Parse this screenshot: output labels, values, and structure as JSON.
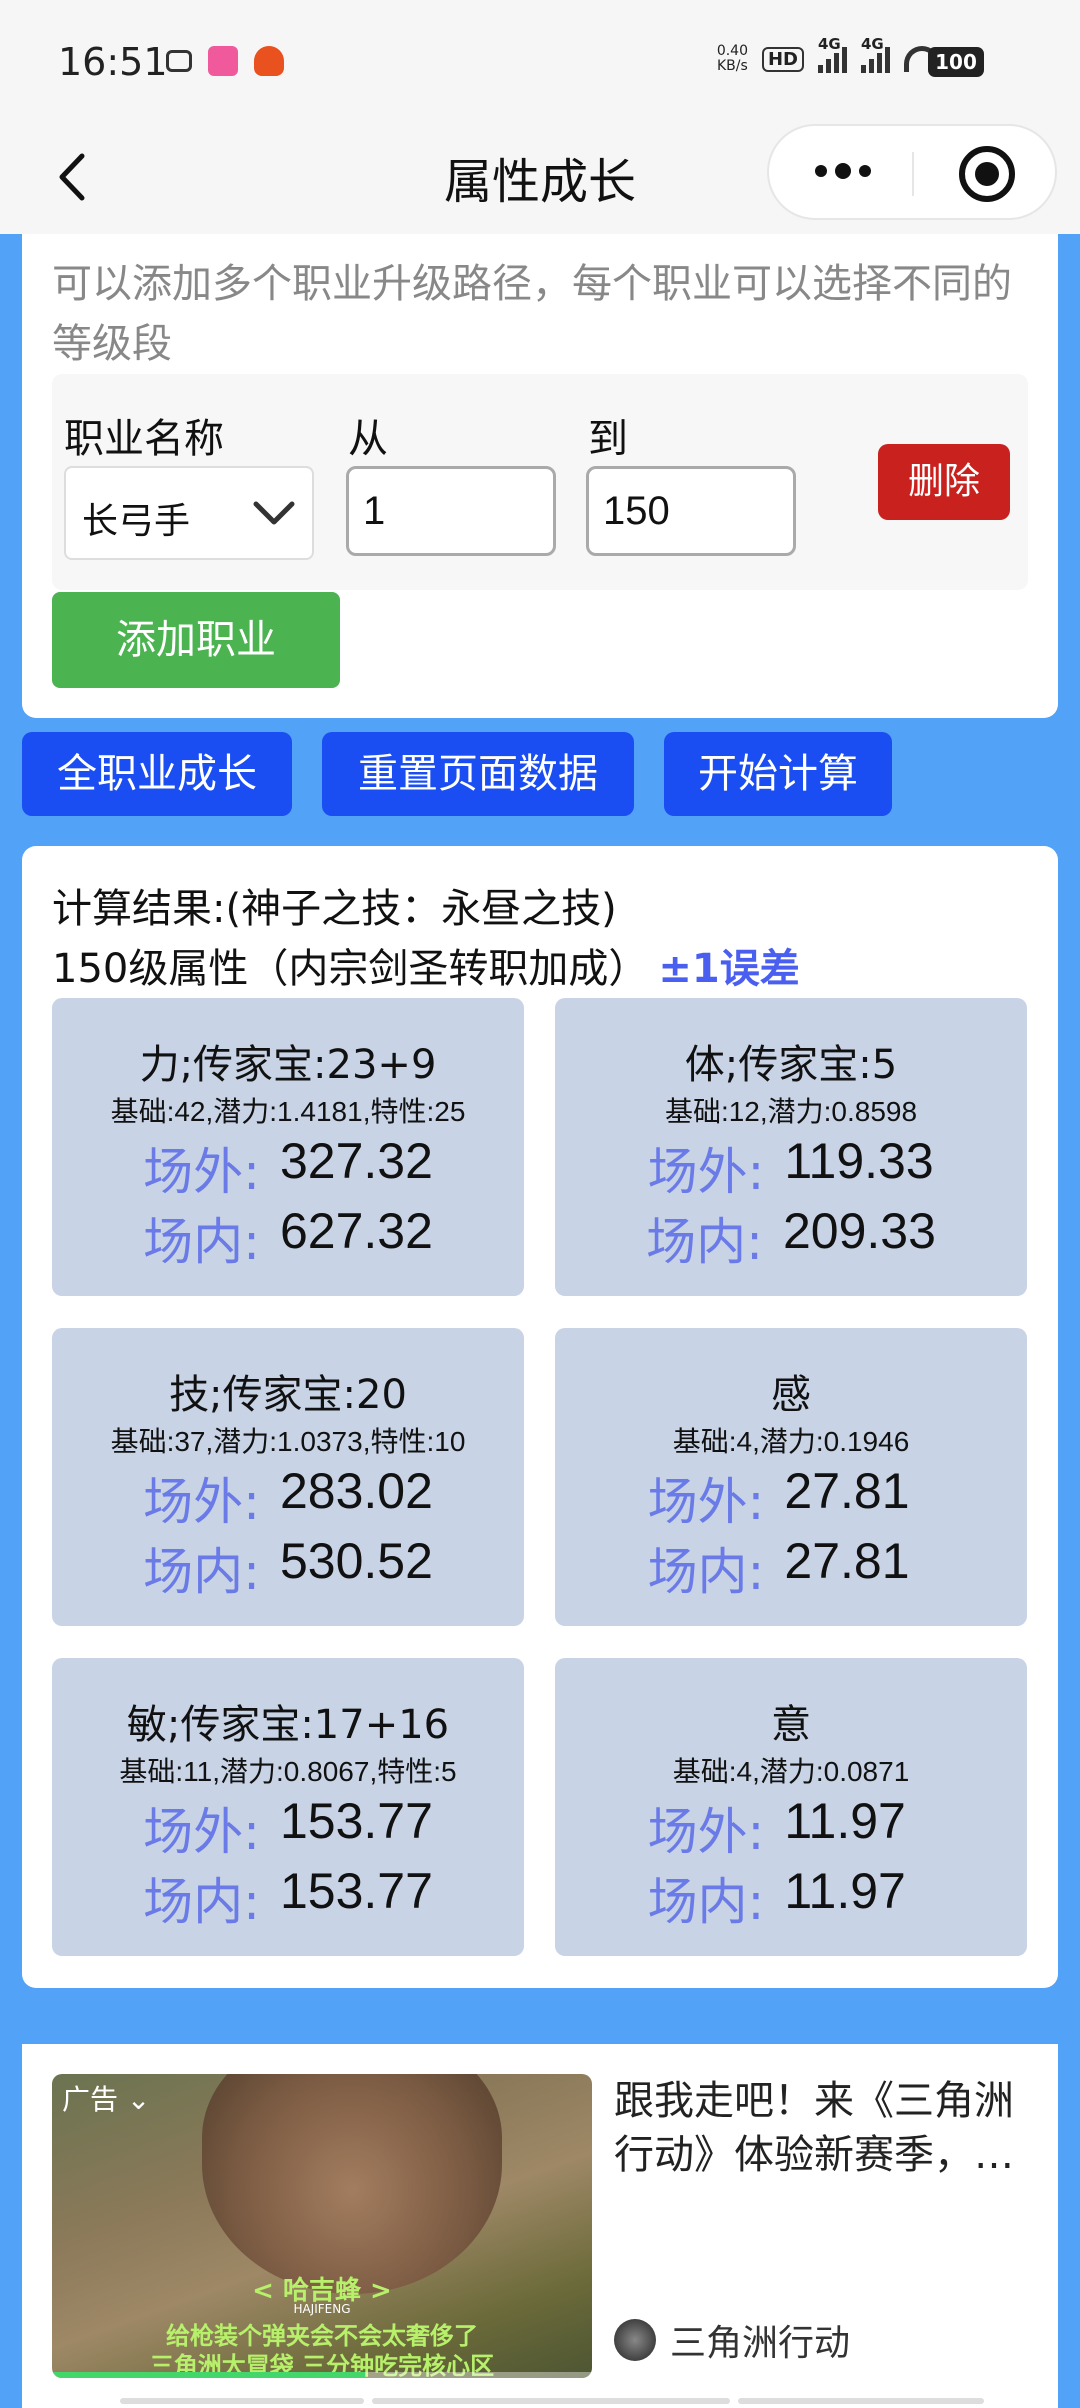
{
  "status": {
    "time": "16:51",
    "netspeed": "0.40",
    "netunit": "KB/s",
    "hd": "HD",
    "net1": "4G",
    "net2": "4G",
    "battery": "100"
  },
  "nav": {
    "title": "属性成长"
  },
  "config": {
    "tip": "可以添加多个职业升级路径，每个职业可以选择不同的等级段",
    "job_label": "职业名称",
    "from_label": "从",
    "to_label": "到",
    "job_value": "长弓手",
    "from_value": "1",
    "to_value": "150",
    "delete_label": "删除",
    "add_label": "添加职业"
  },
  "actions": {
    "all_growth": "全职业成长",
    "reset": "重置页面数据",
    "calculate": "开始计算"
  },
  "result": {
    "title": "计算结果:(神子之技：永昼之技)",
    "subtitle": "150级属性（内宗剑圣转职加成）",
    "error_note": "±1误差",
    "outside_label": "场外:",
    "inside_label": "场内:",
    "stats": [
      {
        "name": "力;传家宝:23+9",
        "base": "基础:42,潜力:1.4181,特性:25",
        "outside": "327.32",
        "inside": "627.32"
      },
      {
        "name": "体;传家宝:5",
        "base": "基础:12,潜力:0.8598",
        "outside": "119.33",
        "inside": "209.33"
      },
      {
        "name": "技;传家宝:20",
        "base": "基础:37,潜力:1.0373,特性:10",
        "outside": "283.02",
        "inside": "530.52"
      },
      {
        "name": "感",
        "base": "基础:4,潜力:0.1946",
        "outside": "27.81",
        "inside": "27.81"
      },
      {
        "name": "敏;传家宝:17+16",
        "base": "基础:11,潜力:0.8067,特性:5",
        "outside": "153.77",
        "inside": "153.77"
      },
      {
        "name": "意",
        "base": "基础:4,潜力:0.0871",
        "outside": "11.97",
        "inside": "11.97"
      }
    ]
  },
  "ad": {
    "tag": "广告",
    "cap1": "< 哈吉蜂 >",
    "cap2": "HAJIFENG",
    "cap3": "给枪装个弹夹会不会太奢侈了",
    "cap4": "三角洲大冒袋 三分钟吃完核心区",
    "text": "跟我走吧！来《三角洲行动》体验新赛季，…",
    "source": "三角洲行动",
    "progress": 0.58
  }
}
